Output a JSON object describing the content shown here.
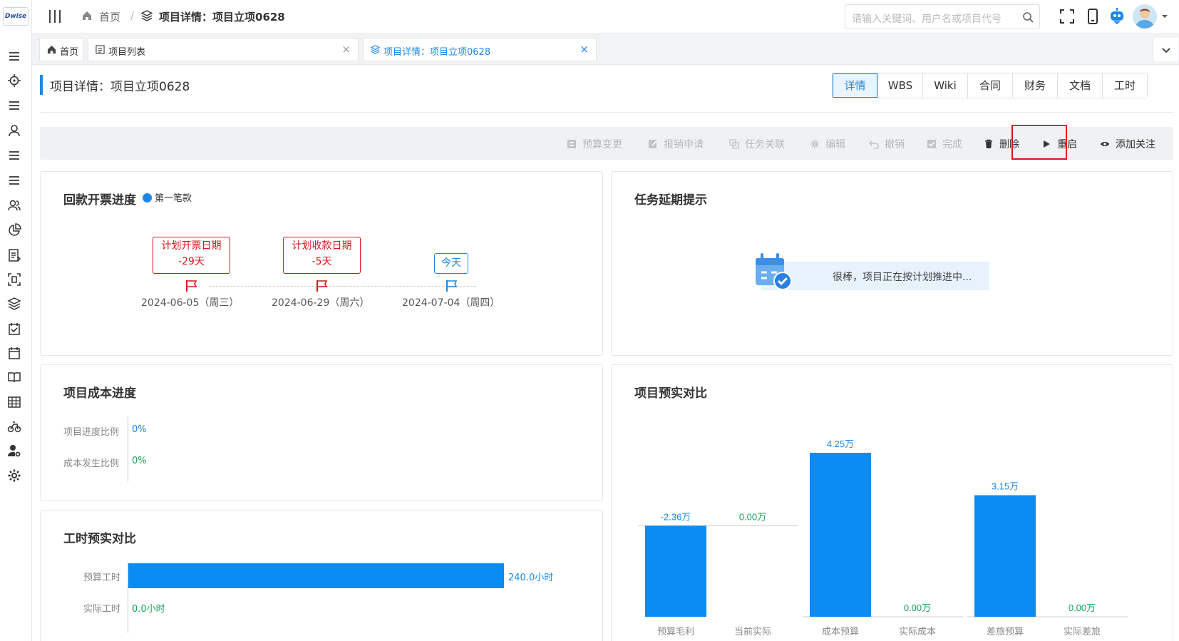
{
  "app": {
    "logo_text": "Dwise"
  },
  "header": {
    "breadcrumb_home": "首页",
    "breadcrumb_current": "项目详情：项目立项0628",
    "search_placeholder": "请输入关键词、用户名或项目代号"
  },
  "tabs": [
    {
      "label": "首页",
      "icon": "home-icon"
    },
    {
      "label": "项目列表",
      "icon": "list-icon"
    },
    {
      "label": "项目详情：项目立项0628",
      "icon": "layers-icon",
      "active": true
    }
  ],
  "page": {
    "title": "项目详情：项目立项0628",
    "segments": [
      "详情",
      "WBS",
      "Wiki",
      "合同",
      "财务",
      "文档",
      "工时"
    ],
    "active_segment": "详情"
  },
  "actions": [
    {
      "label": "预算变更",
      "enabled": false
    },
    {
      "label": "报销申请",
      "enabled": false
    },
    {
      "label": "任务关联",
      "enabled": false
    },
    {
      "label": "编辑",
      "enabled": false
    },
    {
      "label": "撤销",
      "enabled": false
    },
    {
      "label": "完成",
      "enabled": false
    },
    {
      "label": "删除",
      "enabled": true
    },
    {
      "label": "重启",
      "enabled": true,
      "highlighted": true
    },
    {
      "label": "添加关注",
      "enabled": true
    }
  ],
  "payment": {
    "title": "回款开票进度",
    "badge": "第一笔款",
    "milestones": [
      {
        "label": "计划开票日期",
        "days": "-29天",
        "date": "2024-06-05（周三）",
        "kind": "overdue"
      },
      {
        "label": "计划收款日期",
        "days": "-5天",
        "date": "2024-06-29（周六）",
        "kind": "overdue"
      },
      {
        "label": "今天",
        "date": "2024-07-04（周四）",
        "kind": "today"
      }
    ]
  },
  "delay": {
    "title": "任务延期提示",
    "message": "很棒，项目正在按计划推进中..."
  },
  "cost_progress": {
    "title": "项目成本进度",
    "rows": [
      {
        "label": "项目进度比例",
        "value": "0%",
        "color": "#1e88e5"
      },
      {
        "label": "成本发生比例",
        "value": "0%",
        "color": "#18a058"
      }
    ]
  },
  "hours": {
    "title": "工时预实对比",
    "rows": [
      {
        "label": "预算工时",
        "value": 240.0,
        "value_label": "240.0小时",
        "color": "#1e88e5"
      },
      {
        "label": "实际工时",
        "value": 0.0,
        "value_label": "0.0小时",
        "color": "#18a058"
      }
    ]
  },
  "budget": {
    "title": "项目预实对比"
  },
  "chart_data": {
    "type": "bar",
    "title": "项目预实对比",
    "groups": [
      {
        "bars": [
          {
            "category": "预算毛利",
            "value": -2.36,
            "value_label": "-2.36万"
          },
          {
            "category": "当前实际",
            "value": 0.0,
            "value_label": "0.00万"
          }
        ]
      },
      {
        "bars": [
          {
            "category": "成本预算",
            "value": 4.25,
            "value_label": "4.25万"
          },
          {
            "category": "实际成本",
            "value": 0.0,
            "value_label": "0.00万"
          }
        ]
      },
      {
        "bars": [
          {
            "category": "差旅预算",
            "value": 3.15,
            "value_label": "3.15万"
          },
          {
            "category": "实际差旅",
            "value": 0.0,
            "value_label": "0.00万"
          }
        ]
      }
    ],
    "unit": "万",
    "bar_color": "#0a8cf2",
    "label_color_budget": "#1e88e5",
    "label_color_actual": "#18a058"
  }
}
